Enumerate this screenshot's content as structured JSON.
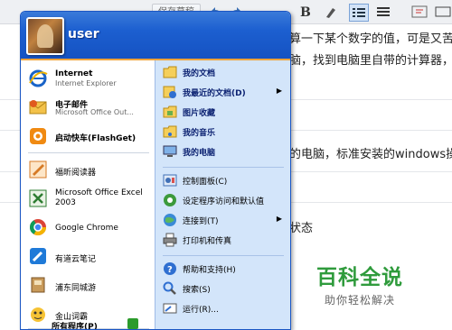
{
  "editor": {
    "toolbar_save": "保存草稿",
    "line1": "算一下某个数字的值，可是又苦于",
    "line2": "脑，找到电脑里自带的计算器，解",
    "line3": "的电脑，标准安装的windows操作",
    "line4": "状态"
  },
  "watermark": {
    "title": "百科全说",
    "subtitle": "助你轻松解决"
  },
  "start_menu": {
    "username": "user",
    "pinned": [
      {
        "label": "Internet",
        "sub": "Internet Explorer"
      },
      {
        "label": "电子邮件",
        "sub": "Microsoft Office Out..."
      }
    ],
    "recent": [
      {
        "label": "启动快车(FlashGet)"
      },
      {
        "label": "福昕阅读器"
      },
      {
        "label": "Microsoft Office Excel 2003"
      },
      {
        "label": "Google Chrome"
      },
      {
        "label": "有道云笔记"
      },
      {
        "label": "浦东同城游"
      },
      {
        "label": "金山词霸"
      }
    ],
    "all_programs": "所有程序(P)",
    "places": [
      {
        "label": "我的文档"
      },
      {
        "label": "我最近的文档(D)"
      },
      {
        "label": "图片收藏"
      },
      {
        "label": "我的音乐"
      },
      {
        "label": "我的电脑"
      }
    ],
    "settings": [
      {
        "label": "控制面板(C)"
      },
      {
        "label": "设定程序访问和默认值"
      },
      {
        "label": "连接到(T)"
      },
      {
        "label": "打印机和传真"
      }
    ],
    "tools": [
      {
        "label": "帮助和支持(H)"
      },
      {
        "label": "搜索(S)"
      },
      {
        "label": "运行(R)..."
      }
    ]
  }
}
